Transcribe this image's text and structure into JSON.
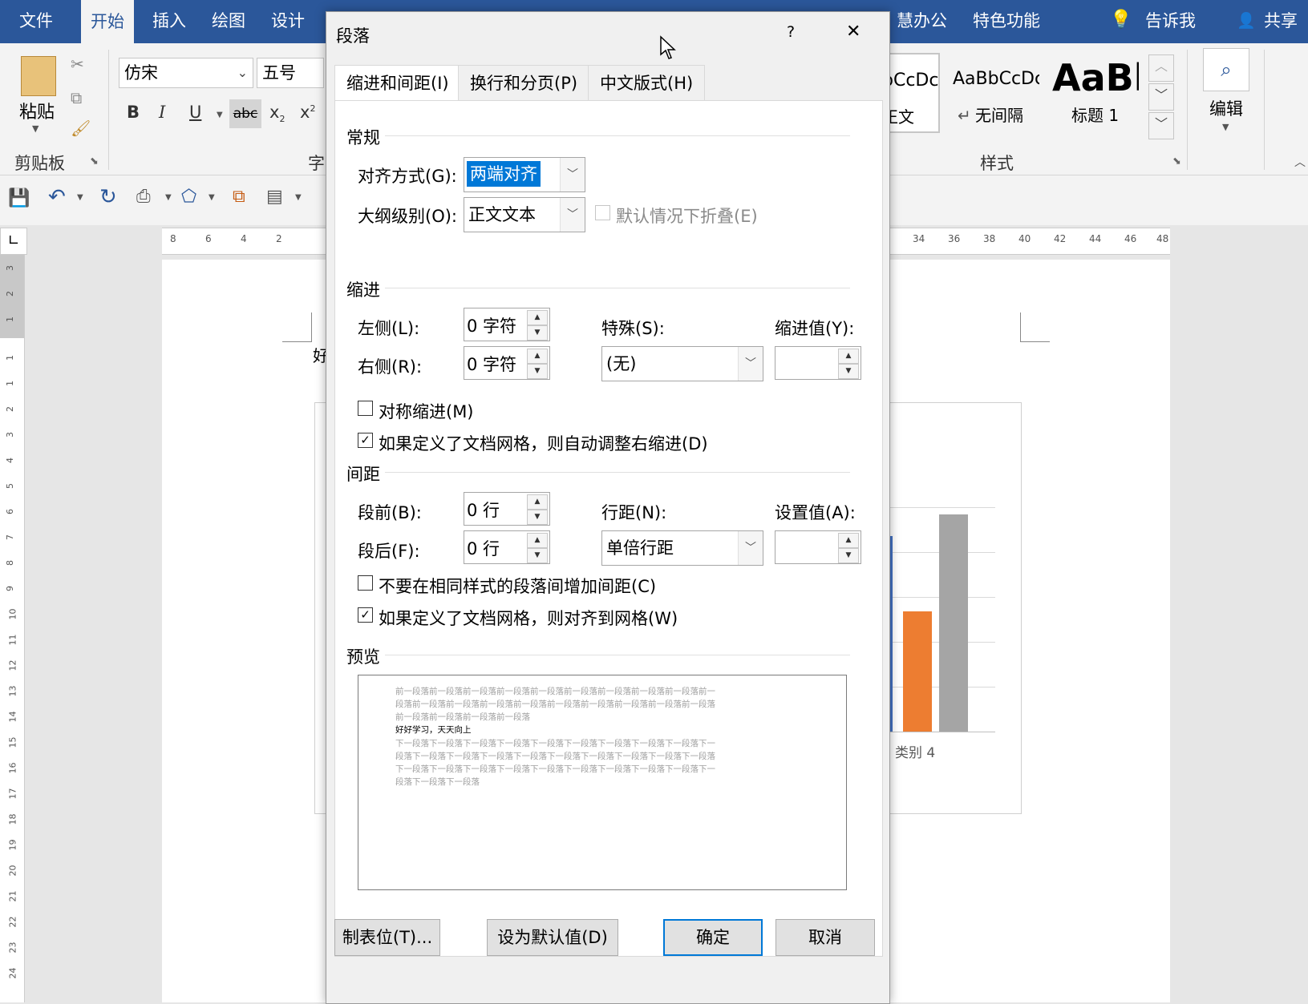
{
  "ribbon": {
    "tabs": [
      "文件",
      "开始",
      "插入",
      "绘图",
      "设计",
      "慧办公",
      "特色功能"
    ],
    "tellme": "告诉我",
    "share": "共享",
    "clipboard": {
      "paste": "粘贴",
      "group": "剪贴板"
    },
    "font": {
      "name": "仿宋",
      "size": "五号",
      "group_fragment": "字"
    },
    "styles": {
      "group": "样式",
      "items": [
        {
          "sample": "bCcDc",
          "name": "正文"
        },
        {
          "sample": "AaBbCcDc",
          "name": "无间隔"
        },
        {
          "sample": "AaBb",
          "name": "标题 1"
        }
      ]
    },
    "editing": "编辑"
  },
  "ruler": {
    "left": [
      "8",
      "6",
      "4",
      "2"
    ],
    "right": [
      "34",
      "36",
      "38",
      "40",
      "42",
      "44",
      "46",
      "48"
    ],
    "vertical": [
      "3",
      "2",
      "1",
      "1",
      "1",
      "2",
      "3",
      "4",
      "5",
      "6",
      "7",
      "8",
      "9",
      "10",
      "11",
      "12",
      "13",
      "14",
      "15",
      "16",
      "17",
      "18",
      "19",
      "20",
      "21",
      "22",
      "23",
      "24"
    ]
  },
  "document": {
    "text_fragment": "好",
    "chart_label": "类别 4",
    "colors": {
      "blue": "#4472c4",
      "orange": "#ed7d31",
      "gray": "#a5a5a5"
    }
  },
  "dialog": {
    "title": "段落",
    "help": "?",
    "close": "✕",
    "tabs": [
      "缩进和间距(I)",
      "换行和分页(P)",
      "中文版式(H)"
    ],
    "general": {
      "heading": "常规",
      "alignment_label": "对齐方式(G):",
      "alignment_value": "两端对齐",
      "outline_label": "大纲级别(O):",
      "outline_value": "正文文本",
      "collapse_label": "默认情况下折叠(E)"
    },
    "indent": {
      "heading": "缩进",
      "left_label": "左侧(L):",
      "left_value": "0 字符",
      "right_label": "右侧(R):",
      "right_value": "0 字符",
      "special_label": "特殊(S):",
      "special_value": "(无)",
      "by_label": "缩进值(Y):",
      "by_value": "",
      "mirror_label": "对称缩进(M)",
      "auto_adjust_label": "如果定义了文档网格，则自动调整右缩进(D)"
    },
    "spacing": {
      "heading": "间距",
      "before_label": "段前(B):",
      "before_value": "0 行",
      "after_label": "段后(F):",
      "after_value": "0 行",
      "line_label": "行距(N):",
      "line_value": "单倍行距",
      "at_label": "设置值(A):",
      "at_value": "",
      "no_space_label": "不要在相同样式的段落间增加间距(C)",
      "snap_grid_label": "如果定义了文档网格，则对齐到网格(W)"
    },
    "preview": {
      "heading": "预览",
      "prev_lines": [
        "前一段落前一段落前一段落前一段落前一段落前一段落前一段落前一段落前一段落前一",
        "段落前一段落前一段落前一段落前一段落前一段落前一段落前一段落前一段落前一段落",
        "前一段落前一段落前一段落前一段落"
      ],
      "main_text": "好好学习，天天向上",
      "next_lines": [
        "下一段落下一段落下一段落下一段落下一段落下一段落下一段落下一段落下一段落下一",
        "段落下一段落下一段落下一段落下一段落下一段落下一段落下一段落下一段落下一段落",
        "下一段落下一段落下一段落下一段落下一段落下一段落下一段落下一段落下一段落下一",
        "段落下一段落下一段落"
      ]
    },
    "buttons": {
      "tabs": "制表位(T)...",
      "default": "设为默认值(D)",
      "ok": "确定",
      "cancel": "取消"
    }
  }
}
